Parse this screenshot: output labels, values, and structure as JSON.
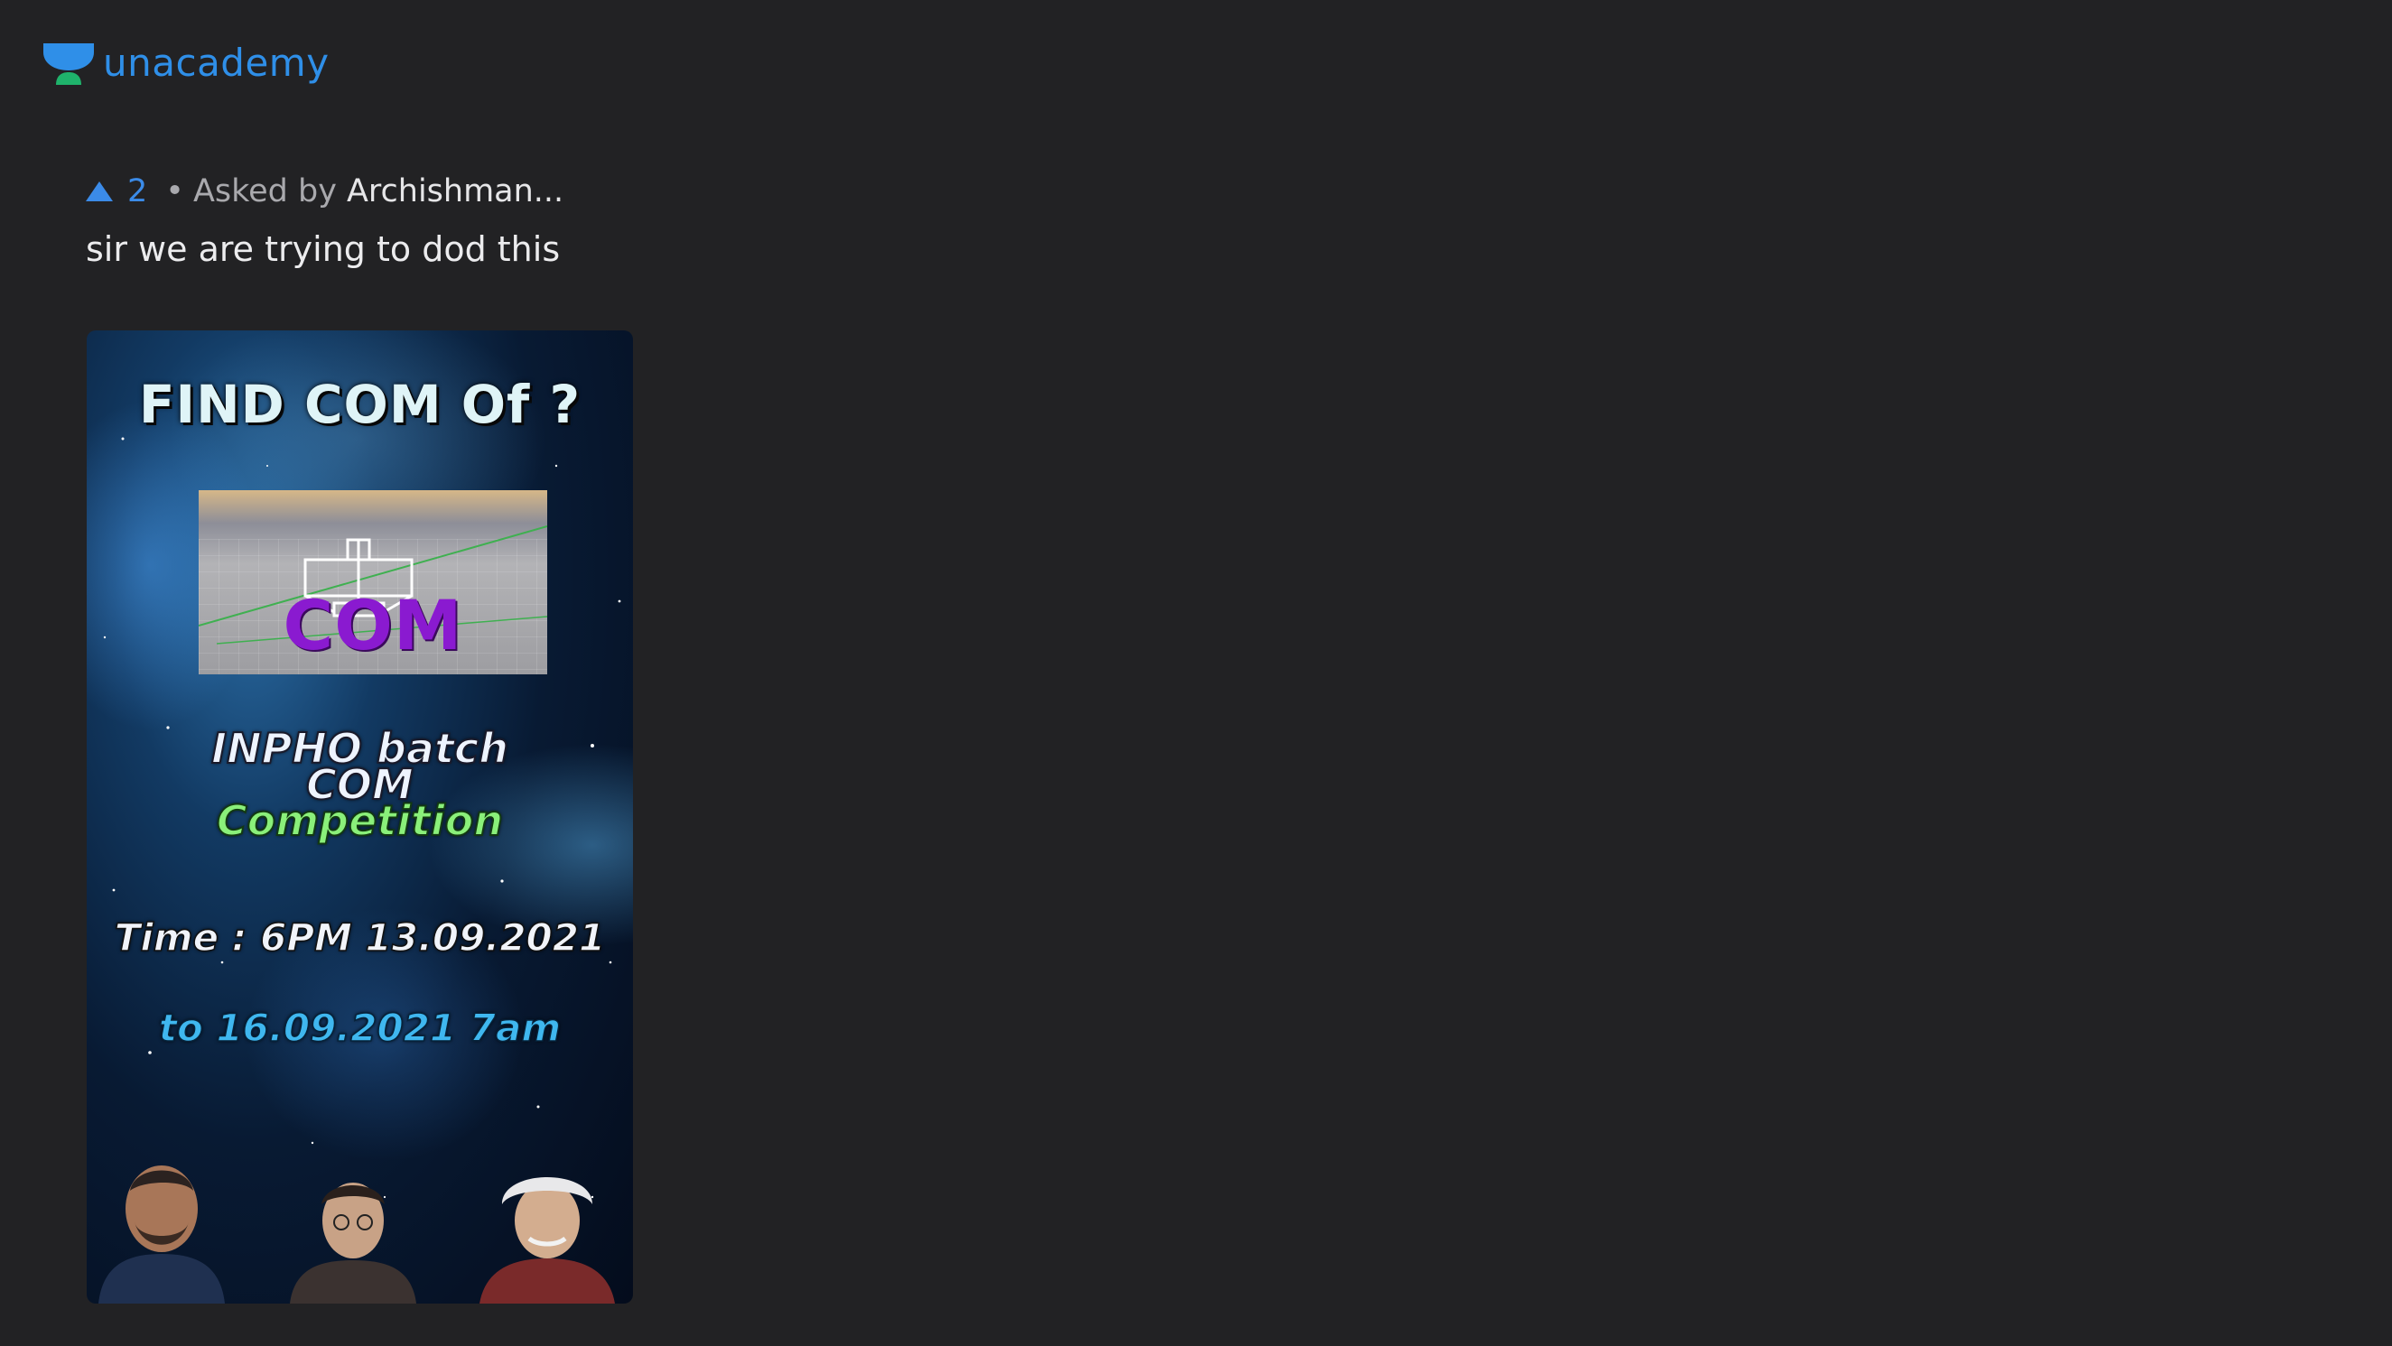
{
  "brand": {
    "name": "unacademy",
    "color": "#2f8fe8",
    "mark_color_top": "#2f8fe8",
    "mark_color_bottom": "#1fb36b"
  },
  "question": {
    "upvote_icon": "triangle-up-icon",
    "upvote_count": "2",
    "separator": "•",
    "asked_by_label": "Asked by",
    "asker_name": "Archishman...",
    "text": "sir we are trying to dod this"
  },
  "attachment": {
    "title": "FIND COM Of ?",
    "inset_label": "COM",
    "line1": "INPHO batch",
    "line2": "COM",
    "line3": "Competition",
    "time_start": "Time : 6PM 13.09.2021",
    "time_end": "to 16.09.2021 7am"
  }
}
